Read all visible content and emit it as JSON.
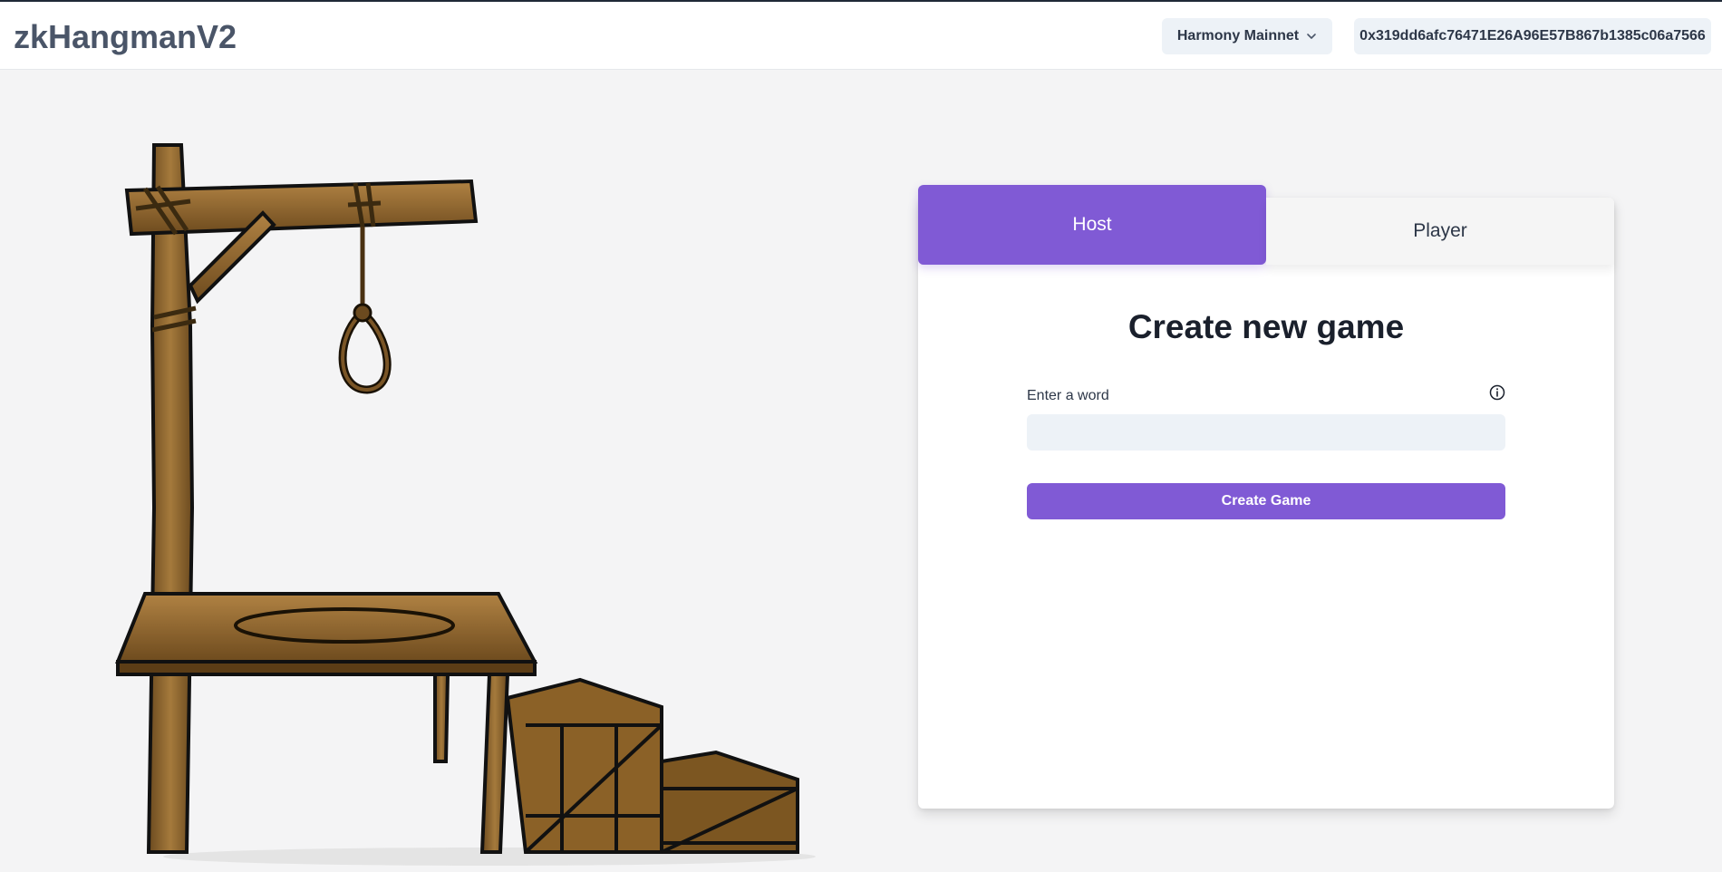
{
  "header": {
    "app_title": "zkHangmanV2",
    "network_label": "Harmony Mainnet",
    "network_icon": "chevron-down-icon",
    "wallet_address": "0x319dd6afc76471E26A96E57B867b1385c06a7566"
  },
  "tabs": [
    {
      "label": "Host",
      "active": true
    },
    {
      "label": "Player",
      "active": false
    }
  ],
  "form": {
    "title": "Create new game",
    "word_label": "Enter a word",
    "word_value": "",
    "word_placeholder": "",
    "info_icon": "info-icon",
    "submit_label": "Create Game"
  },
  "colors": {
    "accent": "#805ad5",
    "title_text": "#4a5568",
    "input_bg": "#edf2f7",
    "page_bg": "#f4f4f5"
  }
}
